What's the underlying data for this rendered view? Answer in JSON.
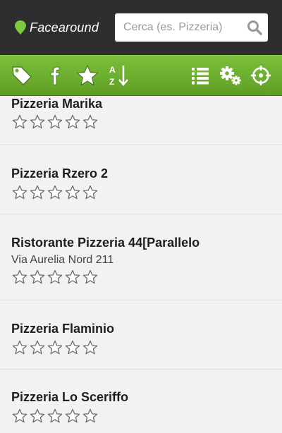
{
  "app": {
    "logo_text": "Facearound"
  },
  "search": {
    "placeholder": "Cerca (es. Pizzeria)",
    "value": ""
  },
  "toolbar": {
    "left": [
      "tag-icon",
      "facebook-icon",
      "star-icon",
      "sort-az-icon"
    ],
    "right": [
      "list-icon",
      "settings-icon",
      "locate-icon"
    ]
  },
  "places": [
    {
      "name": "Pizzeria Marika",
      "address": "",
      "rating": 0
    },
    {
      "name": "Pizzeria Rzero 2",
      "address": "",
      "rating": 0
    },
    {
      "name": "Ristorante Pizzeria 44[Parallelo",
      "address": "Via Aurelia Nord 211",
      "rating": 0
    },
    {
      "name": "Pizzeria Flaminio",
      "address": "",
      "rating": 0
    },
    {
      "name": "Pizzeria Lo Sceriffo",
      "address": "",
      "rating": 0
    }
  ],
  "colors": {
    "header_bg": "#2e2e2e",
    "toolbar_green": "#6bb02e",
    "list_bg": "#f2f2f0"
  }
}
